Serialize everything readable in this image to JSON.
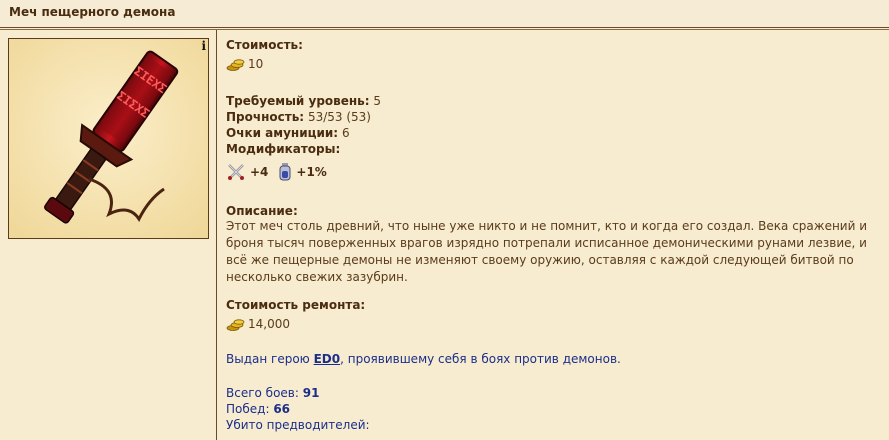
{
  "header": {
    "title": "Меч пещерного демона"
  },
  "item": {
    "info_icon": "i",
    "cost_label": "Стоимость:",
    "cost_value": "10",
    "level_label": "Требуемый уровень:",
    "level_value": "5",
    "durability_label": "Прочность:",
    "durability_value": "53/53  (53)",
    "ammo_label": "Очки амуниции:",
    "ammo_value": "6",
    "modifiers_label": "Модификаторы:",
    "modifiers": [
      {
        "icon": "crossed-swords-icon",
        "value": "+4"
      },
      {
        "icon": "flask-icon",
        "value": "+1%"
      }
    ],
    "description_label": "Описание:",
    "description": "Этот меч столь древний, что ныне уже никто и не помнит, кто и когда его создал. Века сражений и броня тысяч поверженных врагов изрядно потрепали исписанное демоническими рунами лезвие, и всё же пещерные демоны не изменяют своему оружию, оставляя с каждой следующей битвой по несколько свежих зазубрин.",
    "repair_label": "Стоимость ремонта:",
    "repair_value": "14,000",
    "given_prefix": "Выдан герою ",
    "given_hero": "ED0",
    "given_suffix": ", проявившему себя в боях против демонов.",
    "battles_label": "Всего боев: ",
    "battles_value": "91",
    "wins_label": "Побед: ",
    "wins_value": "66",
    "leaders_label": "Убито предводителей:"
  },
  "colors": {
    "background": "#f7ebd0",
    "text": "#5a3c1a",
    "link": "#1b2f8a",
    "blade_red": "#b8141c"
  }
}
